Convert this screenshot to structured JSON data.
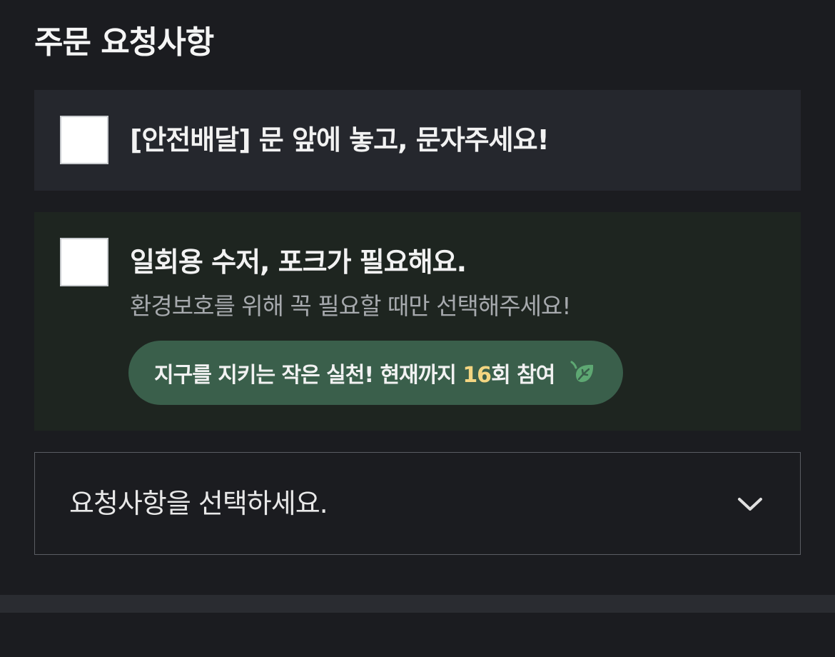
{
  "section": {
    "title": "주문 요청사항"
  },
  "options": {
    "safe_delivery": {
      "label": "[안전배달] 문 앞에 놓고, 문자주세요!",
      "checked": false
    },
    "utensils": {
      "label": "일회용 수저, 포크가 필요해요.",
      "description": "환경보호를 위해 꼭 필요할 때만 선택해주세요!",
      "checked": false,
      "eco_message_prefix": "지구를 지키는 작은 실천! 현재까지 ",
      "eco_count": "16",
      "eco_message_suffix": "회 참여",
      "eco_icon": "leaf-icon"
    }
  },
  "request_select": {
    "placeholder": "요청사항을 선택하세요.",
    "icon": "chevron-down-icon"
  },
  "colors": {
    "background": "#1b1c20",
    "card": "#25272d",
    "eco_card": "#1e2520",
    "eco_pill": "#3a5f4b",
    "eco_count": "#f3d581",
    "leaf": "#5ea873"
  }
}
